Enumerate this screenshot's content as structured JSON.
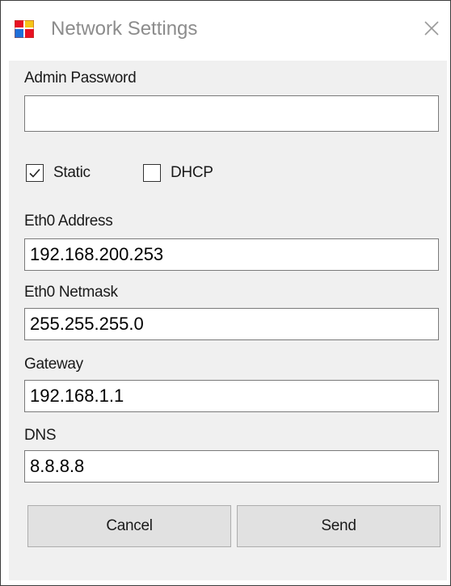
{
  "window": {
    "title": "Network Settings",
    "icon": "app-window-icon",
    "close_icon": "close-icon"
  },
  "form": {
    "admin_password": {
      "label": "Admin Password",
      "value": ""
    },
    "mode": {
      "static": {
        "label": "Static",
        "checked": true
      },
      "dhcp": {
        "label": "DHCP",
        "checked": false
      }
    },
    "eth0_address": {
      "label": "Eth0 Address",
      "value": "192.168.200.253"
    },
    "eth0_netmask": {
      "label": "Eth0 Netmask",
      "value": "255.255.255.0"
    },
    "gateway": {
      "label": "Gateway",
      "value": "192.168.1.1"
    },
    "dns": {
      "label": "DNS",
      "value": "8.8.8.8"
    }
  },
  "buttons": {
    "cancel_label": "Cancel",
    "send_label": "Send"
  },
  "colors": {
    "client_background": "#f0f0f0",
    "title_text": "#8c8c8c",
    "button_face": "#e1e1e1",
    "icon_red": "#e81123",
    "icon_blue": "#1e6fd9",
    "icon_yellow": "#f5c518"
  }
}
